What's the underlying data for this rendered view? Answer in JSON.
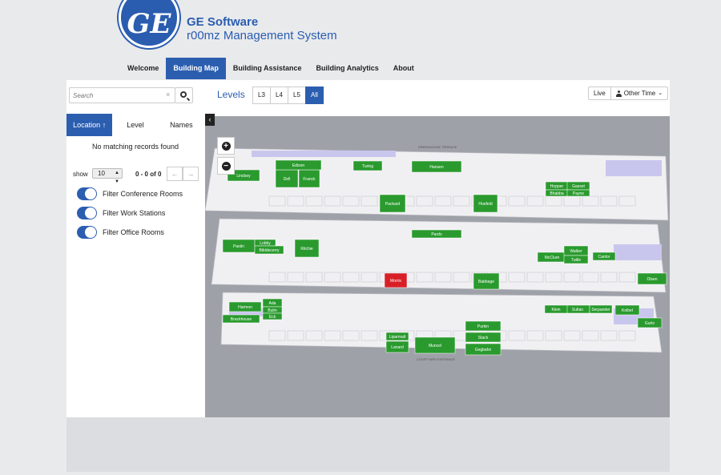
{
  "header": {
    "logo_text": "GE",
    "brand_title": "GE Software",
    "brand_subtitle": "r00mz Management System"
  },
  "nav": {
    "items": [
      {
        "label": "Welcome"
      },
      {
        "label": "Building Map"
      },
      {
        "label": "Building Assistance"
      },
      {
        "label": "Building Analytics"
      },
      {
        "label": "About"
      }
    ],
    "active_index": 1
  },
  "search": {
    "placeholder": "Search",
    "clear": "×"
  },
  "levels": {
    "label": "Levels",
    "buttons": [
      "L3",
      "L4",
      "L5",
      "All"
    ],
    "active": "All"
  },
  "time": {
    "live": "Live",
    "other": "Other Time"
  },
  "left_tabs": {
    "location": "Location",
    "level": "Level",
    "names": "Names"
  },
  "results": {
    "empty_message": "No matching records found",
    "show_label": "show",
    "page_size": "10",
    "page_info": "0 - 0 of 0",
    "prev": "←",
    "next": "→"
  },
  "filters": [
    {
      "label": "Filter Conference Rooms",
      "on": true
    },
    {
      "label": "Filter Work Stations",
      "on": true
    },
    {
      "label": "Filter Office Rooms",
      "on": true
    }
  ],
  "map": {
    "collapse": "‹",
    "zoom_in": "+",
    "zoom_out": "−",
    "rooms": [
      "Lindsey",
      "Dell",
      "Franck",
      "Edison",
      "Turing",
      "Hansen",
      "Packard",
      "Hoefeld",
      "Hopper",
      "Gasset",
      "Bhabba",
      "Payne",
      "Pardo",
      "Pastin",
      "Lobby",
      "Bibldecerry",
      "Ritchie",
      "Morris",
      "Babbage",
      "McClure",
      "Walker",
      "Tuttle",
      "Cantor",
      "Olsen",
      "Harmon",
      "Ada",
      "Bulm",
      "Eck",
      "Brackhouse",
      "Liparmalt",
      "Lanard",
      "Muncel",
      "Purkin",
      "Stack",
      "Gegbahn",
      "Sultan",
      "Serpander",
      "Kolbel",
      "Gurlo",
      "Klein"
    ],
    "highlight_room": "Morris",
    "top_label": "GREENHOUSE TERRACE",
    "bottom_label": "COURTYARD ENTRANCE",
    "colors": {
      "background": "#9ea1a7",
      "floor": "#f0f0f2",
      "room_green": "#2a9a2e",
      "room_red": "#d91f26",
      "room_purple": "#c9c6ee"
    }
  }
}
